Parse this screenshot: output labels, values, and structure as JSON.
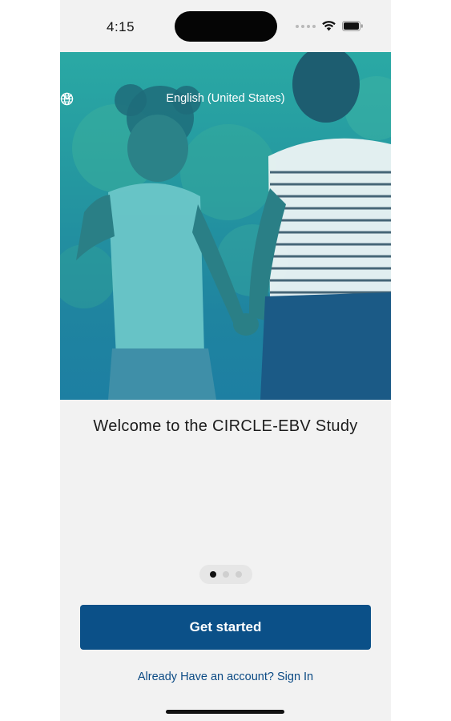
{
  "status_bar": {
    "time": "4:15",
    "icons": [
      "signal-dots-icon",
      "wifi-icon",
      "battery-icon"
    ]
  },
  "hero": {
    "image": "mother-and-daughter-holding-hands-photo",
    "overlay_color": "#2496a0",
    "language_selector": {
      "icon": "globe-icon",
      "label": "English (United States)",
      "chevron": "chevron-down-icon"
    }
  },
  "welcome": {
    "title": "Welcome to the CIRCLE-EBV Study"
  },
  "pager": {
    "total": 3,
    "active_index": 0
  },
  "actions": {
    "primary_label": "Get started",
    "primary_color": "#0b5088",
    "signin_label": "Already Have an account? Sign In",
    "link_color": "#0b4a84"
  }
}
